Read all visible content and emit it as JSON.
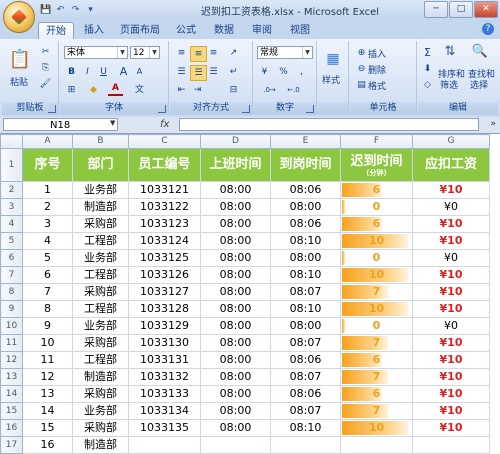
{
  "window": {
    "title": "迟到扣工资表格.xlsx - Microsoft Excel",
    "min_label": "─",
    "max_label": "□",
    "close_label": "✕"
  },
  "qat": {
    "save": "💾",
    "undo": "↶",
    "redo": "↷",
    "more": "▾"
  },
  "tabs": [
    "开始",
    "插入",
    "页面布局",
    "公式",
    "数据",
    "审阅",
    "视图"
  ],
  "ribbon": {
    "clipboard": {
      "paste": "粘贴",
      "label": "剪贴板"
    },
    "font": {
      "name": "宋体",
      "size": "12",
      "label": "字体",
      "bold": "B",
      "italic": "I",
      "underline": "U",
      "grow": "A",
      "shrink": "A",
      "color": "A"
    },
    "alignment": {
      "label": "对齐方式"
    },
    "number": {
      "format": "常规",
      "percent": "%",
      "comma": ",",
      "label": "数字"
    },
    "styles": {
      "style": "样式"
    },
    "cells": {
      "insert": "插入",
      "delete": "删除",
      "format": "格式",
      "label": "单元格"
    },
    "editing": {
      "sigma": "Σ",
      "sort": "排序和",
      "sort2": "筛选",
      "find": "查找和",
      "find2": "选择",
      "label": "编辑"
    }
  },
  "formula_bar": {
    "cell_ref": "N18",
    "fx": "fx",
    "formula": ""
  },
  "columns": [
    "A",
    "B",
    "C",
    "D",
    "E",
    "F",
    "G"
  ],
  "headers": {
    "seq": "序号",
    "dept": "部门",
    "emp_id": "员工编号",
    "work_time": "上班时间",
    "arrive_time": "到岗时间",
    "late_time": "迟到时间",
    "late_unit": "(分钟)",
    "deduction": "应扣工资"
  },
  "rows": [
    {
      "row": "2",
      "seq": "1",
      "dept": "业务部",
      "id": "1033121",
      "start": "08:00",
      "arrive": "08:06",
      "late": "6",
      "fine": "¥10"
    },
    {
      "row": "3",
      "seq": "2",
      "dept": "制造部",
      "id": "1033122",
      "start": "08:00",
      "arrive": "08:00",
      "late": "0",
      "fine": "¥0"
    },
    {
      "row": "4",
      "seq": "3",
      "dept": "采购部",
      "id": "1033123",
      "start": "08:00",
      "arrive": "08:06",
      "late": "6",
      "fine": "¥10"
    },
    {
      "row": "5",
      "seq": "4",
      "dept": "工程部",
      "id": "1033124",
      "start": "08:00",
      "arrive": "08:10",
      "late": "10",
      "fine": "¥10"
    },
    {
      "row": "6",
      "seq": "5",
      "dept": "业务部",
      "id": "1033125",
      "start": "08:00",
      "arrive": "08:00",
      "late": "0",
      "fine": "¥0"
    },
    {
      "row": "7",
      "seq": "6",
      "dept": "工程部",
      "id": "1033126",
      "start": "08:00",
      "arrive": "08:10",
      "late": "10",
      "fine": "¥10"
    },
    {
      "row": "8",
      "seq": "7",
      "dept": "采购部",
      "id": "1033127",
      "start": "08:00",
      "arrive": "08:07",
      "late": "7",
      "fine": "¥10"
    },
    {
      "row": "9",
      "seq": "8",
      "dept": "工程部",
      "id": "1033128",
      "start": "08:00",
      "arrive": "08:10",
      "late": "10",
      "fine": "¥10"
    },
    {
      "row": "10",
      "seq": "9",
      "dept": "业务部",
      "id": "1033129",
      "start": "08:00",
      "arrive": "08:00",
      "late": "0",
      "fine": "¥0"
    },
    {
      "row": "11",
      "seq": "10",
      "dept": "采购部",
      "id": "1033130",
      "start": "08:00",
      "arrive": "08:07",
      "late": "7",
      "fine": "¥10"
    },
    {
      "row": "12",
      "seq": "11",
      "dept": "工程部",
      "id": "1033131",
      "start": "08:00",
      "arrive": "08:06",
      "late": "6",
      "fine": "¥10"
    },
    {
      "row": "13",
      "seq": "12",
      "dept": "制造部",
      "id": "1033132",
      "start": "08:00",
      "arrive": "08:07",
      "late": "7",
      "fine": "¥10"
    },
    {
      "row": "14",
      "seq": "13",
      "dept": "采购部",
      "id": "1033133",
      "start": "08:00",
      "arrive": "08:06",
      "late": "6",
      "fine": "¥10"
    },
    {
      "row": "15",
      "seq": "14",
      "dept": "业务部",
      "id": "1033134",
      "start": "08:00",
      "arrive": "08:07",
      "late": "7",
      "fine": "¥10"
    },
    {
      "row": "16",
      "seq": "15",
      "dept": "采购部",
      "id": "1033135",
      "start": "08:00",
      "arrive": "08:10",
      "late": "10",
      "fine": "¥10"
    },
    {
      "row": "17",
      "seq": "16",
      "dept": "制造部",
      "id": "",
      "start": "",
      "arrive": "",
      "late": "",
      "fine": ""
    }
  ],
  "colors": {
    "header_green": "#8dc63f",
    "fine_red": "#e02020",
    "late_orange": "#f0a020"
  },
  "late_max": 10
}
